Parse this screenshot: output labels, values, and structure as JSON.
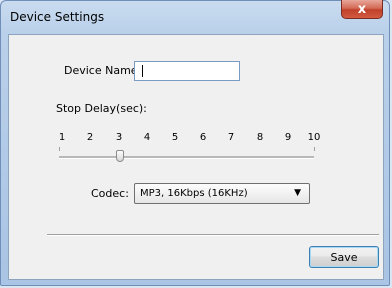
{
  "window": {
    "title": "Device Settings",
    "close_label": "x"
  },
  "form": {
    "device_name_label": "Device Name:",
    "device_name_value": "",
    "stop_delay_label": "Stop Delay(sec):",
    "stop_delay_ticks": [
      "1",
      "2",
      "3",
      "4",
      "5",
      "6",
      "7",
      "8",
      "9",
      "10"
    ],
    "stop_delay_value": 3,
    "codec_label": "Codec:",
    "codec_selected": "MP3, 16Kbps (16KHz)",
    "codec_arrow": "▼"
  },
  "buttons": {
    "save_label": "Save"
  },
  "colors": {
    "close_button": "#c9493a",
    "save_border": "#3c7fb1"
  }
}
